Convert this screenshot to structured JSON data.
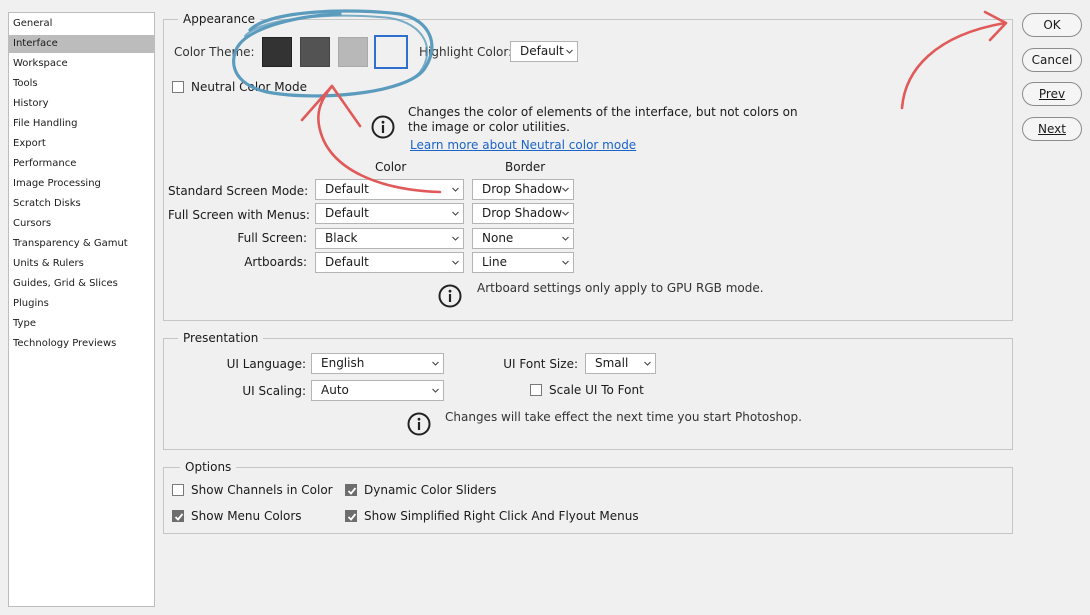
{
  "sidebar": {
    "items": [
      {
        "label": "General"
      },
      {
        "label": "Interface",
        "active": true
      },
      {
        "label": "Workspace"
      },
      {
        "label": "Tools"
      },
      {
        "label": "History"
      },
      {
        "label": "File Handling"
      },
      {
        "label": "Export"
      },
      {
        "label": "Performance"
      },
      {
        "label": "Image Processing"
      },
      {
        "label": "Scratch Disks"
      },
      {
        "label": "Cursors"
      },
      {
        "label": "Transparency & Gamut"
      },
      {
        "label": "Units & Rulers"
      },
      {
        "label": "Guides, Grid & Slices"
      },
      {
        "label": "Plugins"
      },
      {
        "label": "Type"
      },
      {
        "label": "Technology Previews"
      }
    ]
  },
  "appearance": {
    "legend": "Appearance",
    "color_theme_label": "Color Theme:",
    "themes": [
      {
        "name": "darkest",
        "color": "#333333"
      },
      {
        "name": "dark",
        "color": "#535353"
      },
      {
        "name": "medium",
        "color": "#b8b8b8"
      },
      {
        "name": "light",
        "color": "#f0f0f0",
        "selected": true
      }
    ],
    "highlight_label": "Highlight Color:",
    "highlight_value": "Default",
    "neutral_label": "Neutral Color Mode",
    "neutral_checked": false,
    "neutral_info": "Changes the color of elements of the interface, but not colors on the image or color utilities.",
    "neutral_link": "Learn more about Neutral color mode",
    "col_color": "Color",
    "col_border": "Border",
    "rows": [
      {
        "label": "Standard Screen Mode:",
        "color": "Default",
        "border": "Drop Shadow"
      },
      {
        "label": "Full Screen with Menus:",
        "color": "Default",
        "border": "Drop Shadow"
      },
      {
        "label": "Full Screen:",
        "color": "Black",
        "border": "None"
      },
      {
        "label": "Artboards:",
        "color": "Default",
        "border": "Line"
      }
    ],
    "artboard_info": "Artboard settings only apply to GPU RGB mode."
  },
  "presentation": {
    "legend": "Presentation",
    "language_label": "UI Language:",
    "language_value": "English",
    "font_size_label": "UI Font Size:",
    "font_size_value": "Small",
    "scaling_label": "UI Scaling:",
    "scaling_value": "Auto",
    "scale_font_label": "Scale UI To Font",
    "scale_font_checked": false,
    "info": "Changes will take effect the next time you start Photoshop."
  },
  "options": {
    "legend": "Options",
    "items": [
      {
        "label": "Show Channels in Color",
        "checked": false
      },
      {
        "label": "Dynamic Color Sliders",
        "checked": true
      },
      {
        "label": "Show Menu Colors",
        "checked": true
      },
      {
        "label": "Show Simplified Right Click And Flyout Menus",
        "checked": true
      }
    ]
  },
  "buttons": {
    "ok": "OK",
    "cancel": "Cancel",
    "prev": "Prev",
    "next": "Next"
  },
  "annotation_colors": {
    "circle": "#5b9bbd",
    "arrow": "#e05a5a"
  },
  "accent": "#1a63c9"
}
